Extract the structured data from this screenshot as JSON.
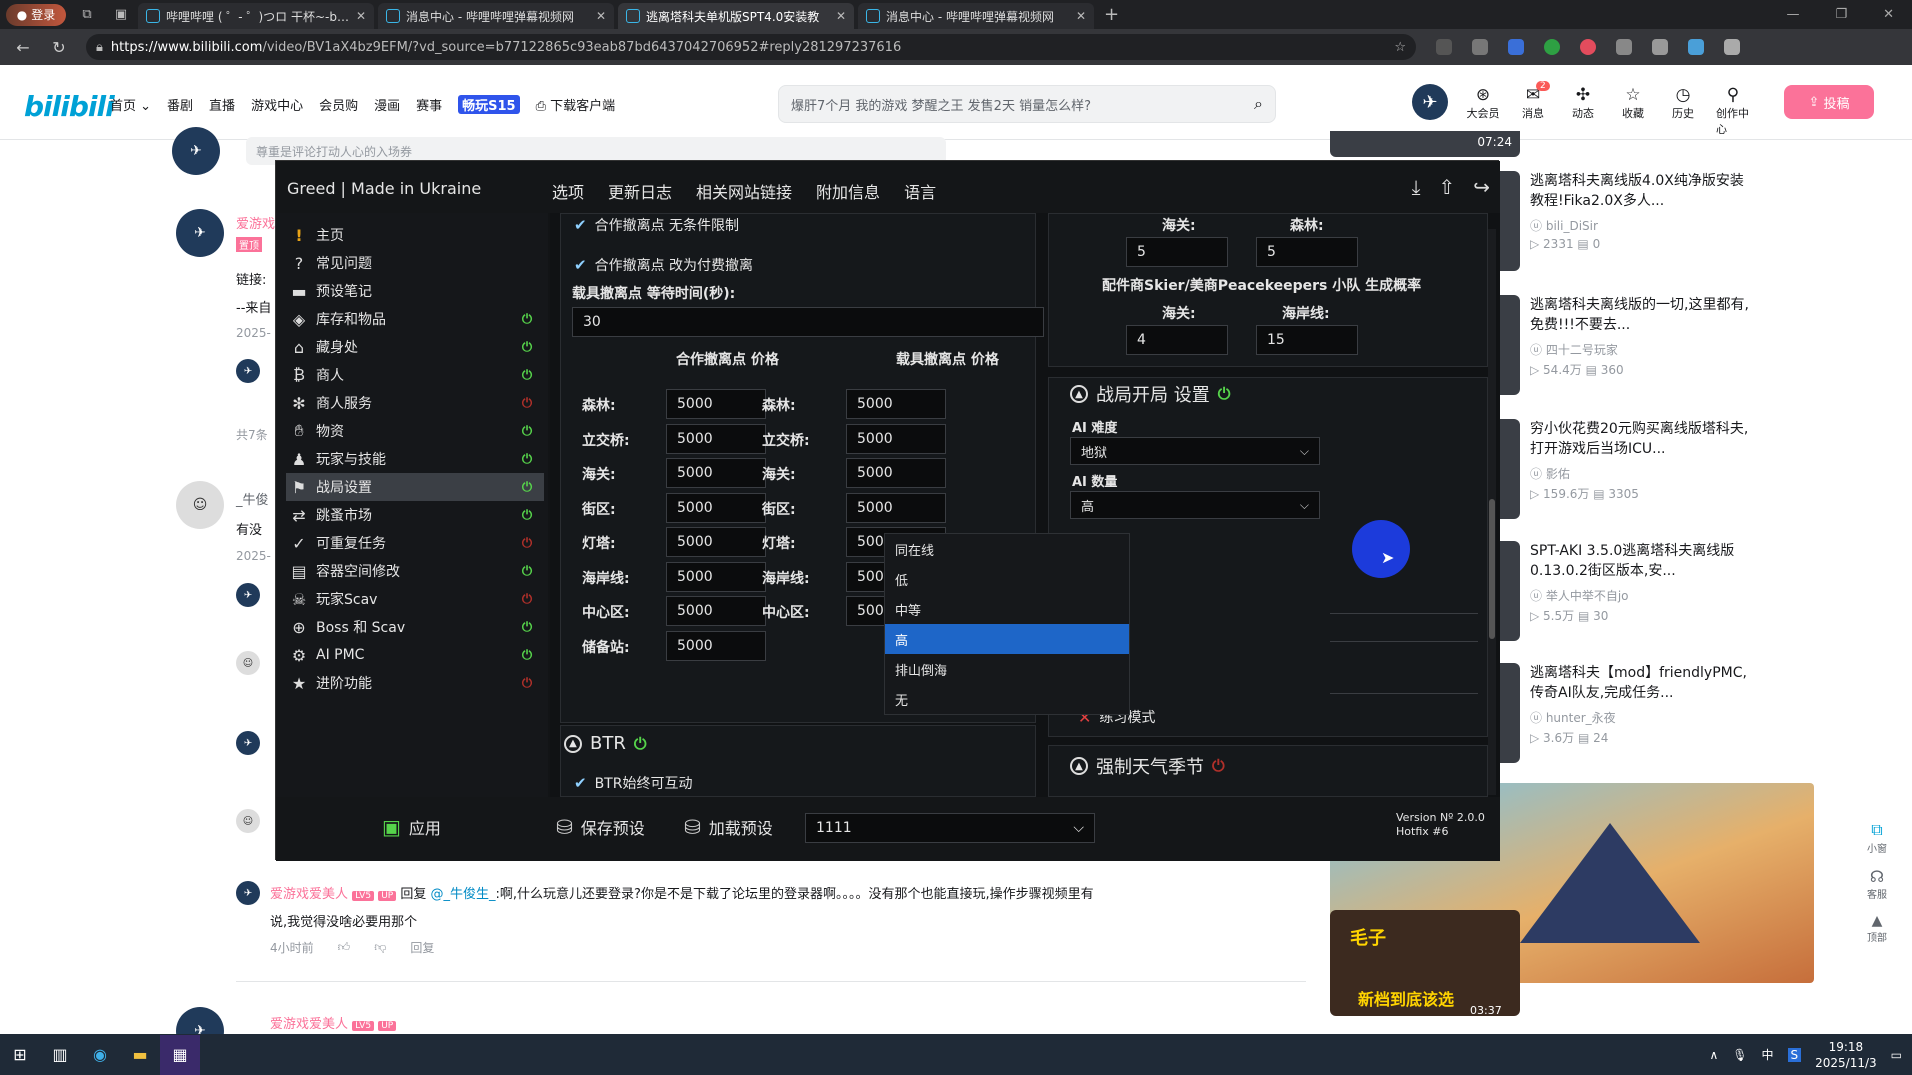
{
  "browser": {
    "login": "登录",
    "tabs": [
      {
        "title": "哔哩哔哩 ( ゜- ゜)つロ 干杯~-bilib",
        "active": false
      },
      {
        "title": "消息中心 - 哔哩哔哩弹幕视频网",
        "active": false
      },
      {
        "title": "逃离塔科夫单机版SPT4.0安装教",
        "active": true
      },
      {
        "title": "消息中心 - 哔哩哔哩弹幕视频网",
        "active": false
      }
    ],
    "url_host": "https://www.bilibili.com",
    "url_path": "/video/BV1aX4bz9EFM/?vd_source=b77122865c93eab87bd6437042706952#reply281297237616"
  },
  "header": {
    "logo": "bilibili",
    "nav": [
      "首页 ⌄",
      "番剧",
      "直播",
      "游戏中心",
      "会员购",
      "漫画",
      "赛事"
    ],
    "nav_highlight": "畅玩S15",
    "download": "下载客户端",
    "search_placeholder": "爆肝7个月 我的游戏 梦醒之王 发售2天 销量怎么样?",
    "icons": [
      {
        "label": "大会员",
        "icon": "vip-icon"
      },
      {
        "label": "消息",
        "icon": "message-icon",
        "badge": "2"
      },
      {
        "label": "动态",
        "icon": "dynamic-icon"
      },
      {
        "label": "收藏",
        "icon": "favorite-icon"
      },
      {
        "label": "历史",
        "icon": "history-icon"
      },
      {
        "label": "创作中心",
        "icon": "creator-icon"
      }
    ],
    "upload": "投稿"
  },
  "comments": {
    "input_placeholder": "尊重是评论打动人心的入场券",
    "first_user": "爱游戏",
    "first_tag": "置顶",
    "first_line1": "链接:",
    "first_line2": "--来自",
    "first_date": "2025-",
    "total": "共7条",
    "user_niu": "_牛俊",
    "niu_line": "有没",
    "niu_date": "2025-",
    "reply_user": "爱游戏爱美人",
    "reply_lv": "LV5",
    "reply_up": "UP",
    "reply_prefix": "回复",
    "reply_at": "@_牛俊生_",
    "reply_text": ":啊,什么玩意儿还要登录?你是不是下载了论坛里的登录器啊。。。。没有那个也能直接玩,操作步骤视频里有",
    "reply_text2": "说,我觉得没啥必要用那个",
    "reply_time": "4小时前",
    "reply_btn": "回复",
    "bottom_user": "爱游戏爱美人"
  },
  "recs": [
    {
      "title": "逃离塔科夫离线版4.0X纯净版安装教程!Fika2.0X多人...",
      "author": "bili_DiSir",
      "views": "2331",
      "danmaku": "0"
    },
    {
      "title": "逃离塔科夫离线版的一切,这里都有,免费!!!不要去...",
      "author": "四十二号玩家",
      "views": "54.4万",
      "danmaku": "360"
    },
    {
      "title": "穷小伙花费20元购买离线版塔科夫,打开游戏后当场ICU...",
      "author": "影佑",
      "views": "159.6万",
      "danmaku": "3305"
    },
    {
      "title": "SPT-AKI 3.5.0逃离塔科夫离线版0.13.0.2街区版本,安...",
      "author": "举人中举不自jo",
      "views": "5.5万",
      "danmaku": "30"
    },
    {
      "title": "逃离塔科夫【mod】friendlyPMC,传奇AI队友,完成任务...",
      "author": "hunter_永夜",
      "views": "3.6万",
      "danmaku": "24"
    }
  ],
  "rec_top_duration": "07:24",
  "mini_thumb": {
    "text": "新档到底该选",
    "duration": "03:37",
    "tag": "毛子"
  },
  "float_btns": [
    "小窗",
    "客服",
    "顶部"
  ],
  "tool": {
    "title": "Greed | Made in Ukraine",
    "menu": [
      "选项",
      "更新日志",
      "相关网站链接",
      "附加信息",
      "语言"
    ],
    "sidebar": [
      {
        "label": "主页",
        "icon": "warning-icon",
        "power": null
      },
      {
        "label": "常见问题",
        "icon": "question-icon",
        "power": null
      },
      {
        "label": "预设笔记",
        "icon": "book-icon",
        "power": null
      },
      {
        "label": "库存和物品",
        "icon": "box-icon",
        "power": "on"
      },
      {
        "label": "藏身处",
        "icon": "hideout-icon",
        "power": "on"
      },
      {
        "label": "商人",
        "icon": "coin-icon",
        "power": "on"
      },
      {
        "label": "商人服务",
        "icon": "gear-icon",
        "power": "off"
      },
      {
        "label": "物资",
        "icon": "hand-icon",
        "power": "on"
      },
      {
        "label": "玩家与技能",
        "icon": "person-icon",
        "power": "on"
      },
      {
        "label": "战局设置",
        "icon": "raid-icon",
        "power": "on",
        "active": true
      },
      {
        "label": "跳蚤市场",
        "icon": "market-icon",
        "power": "on"
      },
      {
        "label": "可重复任务",
        "icon": "check-icon",
        "power": "off"
      },
      {
        "label": "容器空间修改",
        "icon": "container-icon",
        "power": "on"
      },
      {
        "label": "玩家Scav",
        "icon": "scav-icon",
        "power": "off"
      },
      {
        "label": "Boss 和 Scav",
        "icon": "boss-icon",
        "power": "on"
      },
      {
        "label": "AI PMC",
        "icon": "ai-icon",
        "power": "on"
      },
      {
        "label": "进阶功能",
        "icon": "star-icon",
        "power": "off"
      }
    ],
    "coop_unlimited": "合作撤离点 无条件限制",
    "coop_paid": "合作撤离点 改为付费撤离",
    "vehicle_wait_label": "载具撤离点 等待时间(秒):",
    "vehicle_wait_value": "30",
    "coop_price_header": "合作撤离点 价格",
    "vehicle_price_header": "载具撤离点 价格",
    "coop_prices": [
      {
        "map": "森林:",
        "value": "5000"
      },
      {
        "map": "立交桥:",
        "value": "5000"
      },
      {
        "map": "海关:",
        "value": "5000"
      },
      {
        "map": "街区:",
        "value": "5000"
      },
      {
        "map": "灯塔:",
        "value": "5000"
      },
      {
        "map": "海岸线:",
        "value": "5000"
      },
      {
        "map": "中心区:",
        "value": "5000"
      },
      {
        "map": "储备站:",
        "value": "5000"
      }
    ],
    "vehicle_prices": [
      {
        "map": "森林:",
        "value": "5000"
      },
      {
        "map": "立交桥:",
        "value": "5000"
      },
      {
        "map": "海关:",
        "value": "5000"
      },
      {
        "map": "街区:",
        "value": "5000"
      },
      {
        "map": "灯塔:",
        "value": "5000"
      },
      {
        "map": "海岸线:",
        "value": "5000"
      },
      {
        "map": "中心区:",
        "value": "5000"
      }
    ],
    "btr_title": "BTR",
    "btr_interact": "BTR始终可互动",
    "top_right": {
      "customs_label": "海关:",
      "woods_label": "森林:",
      "customs_value": "5",
      "woods_value": "5",
      "squad_title": "配件商Skier/美商Peacekeepers 小队 生成概率",
      "customs_label2": "海关:",
      "shoreline_label": "海岸线:",
      "customs_value2": "4",
      "shoreline_value": "15"
    },
    "raid_start_title": "战局开局 设置",
    "ai_difficulty_label": "AI 难度",
    "ai_difficulty_value": "地狱",
    "ai_amount_label": "AI 数量",
    "ai_amount_value": "高",
    "ai_amount_options": [
      "同在线",
      "低",
      "中等",
      "高",
      "排山倒海",
      "无"
    ],
    "ai_amount_selected_index": 3,
    "practice_mode": "练习模式",
    "weather_title": "强制天气季节",
    "footer": {
      "apply": "应用",
      "save_preset": "保存预设",
      "load_preset": "加载预设",
      "preset_value": "1111",
      "version": "Version Nº 2.0.0",
      "hotfix": "Hotfix #6"
    }
  },
  "taskbar": {
    "lang": "中",
    "time": "19:18",
    "date": "2025/11/3"
  }
}
